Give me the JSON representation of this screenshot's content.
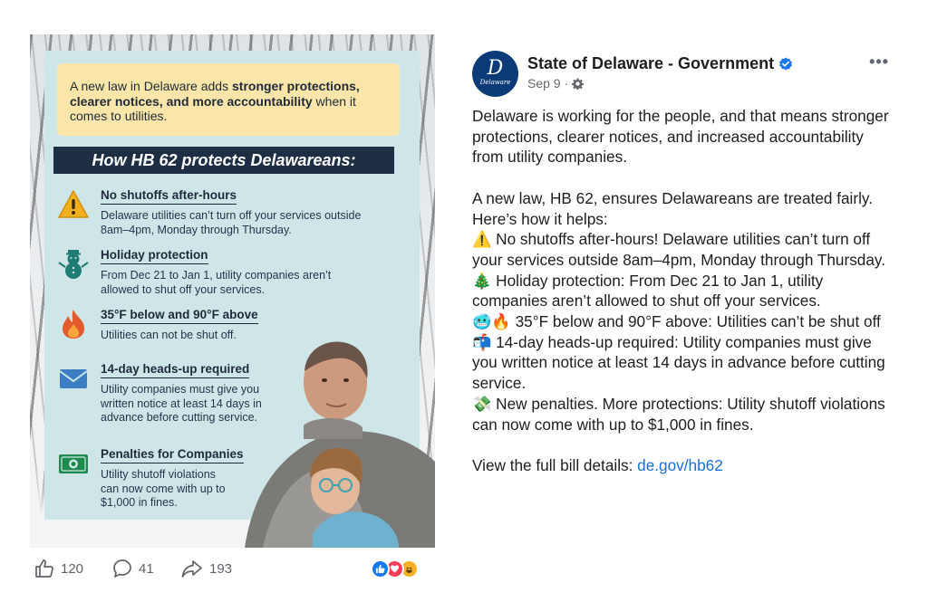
{
  "image": {
    "notice_prefix": "A new law in Delaware adds ",
    "notice_bold": "stronger protections, clearer notices, and more accountability",
    "notice_suffix": " when it comes to utilities.",
    "banner": "How HB 62 protects Delawareans:",
    "items": [
      {
        "title": "No shutoffs after-hours",
        "text": "Delaware utilities can’t turn off your services outside 8am–4pm, Monday through Thursday.",
        "icon": "warning-icon"
      },
      {
        "title": "Holiday protection",
        "text": "From Dec 21 to Jan 1, utility companies aren’t allowed to shut off your services.",
        "icon": "snowman-icon"
      },
      {
        "title": "35°F below and 90°F above",
        "text": "Utilities can not be shut off.",
        "icon": "flame-icon"
      },
      {
        "title": "14-day heads-up required",
        "text": "Utility companies must give you written notice at least 14 days in advance before cutting service.",
        "icon": "envelope-icon"
      },
      {
        "title": "Penalties for Companies",
        "text": "Utility shutoff violations can now come with up to $1,000 in fines.",
        "icon": "money-icon"
      }
    ]
  },
  "actions": {
    "likes": "120",
    "comments": "41",
    "shares": "193"
  },
  "post": {
    "page_name": "State of Delaware - Government",
    "date": "Sep 9",
    "avatar_mono": "D",
    "avatar_word": "Delaware",
    "lines": [
      "Delaware is working for the people, and that means stronger protections, clearer notices, and increased accountability from utility companies.",
      "A new law, HB 62, ensures Delawareans are treated fairly. Here’s how it helps:",
      "⚠️ No shutoffs after-hours! Delaware utilities can’t turn off your services outside 8am–4pm, Monday through Thursday.",
      "🎄 Holiday protection: From Dec 21 to Jan 1, utility companies aren’t allowed to shut off your services.",
      "🥶🔥 35°F below and 90°F above: Utilities can’t be shut off",
      "📬 14-day heads-up required: Utility companies must give you written notice at least 14 days in advance before cutting service.",
      "💸 New penalties. More protections: Utility shutoff violations can now come with up to $1,000 in fines."
    ],
    "link_prefix": "View the full bill details: ",
    "link_text": "de.gov/hb62"
  },
  "colors": {
    "panel": "#cfe6e9",
    "notice": "#fbe5a8",
    "banner": "#1e2f45",
    "link": "#1a6fd4",
    "verified": "#1877f2"
  }
}
